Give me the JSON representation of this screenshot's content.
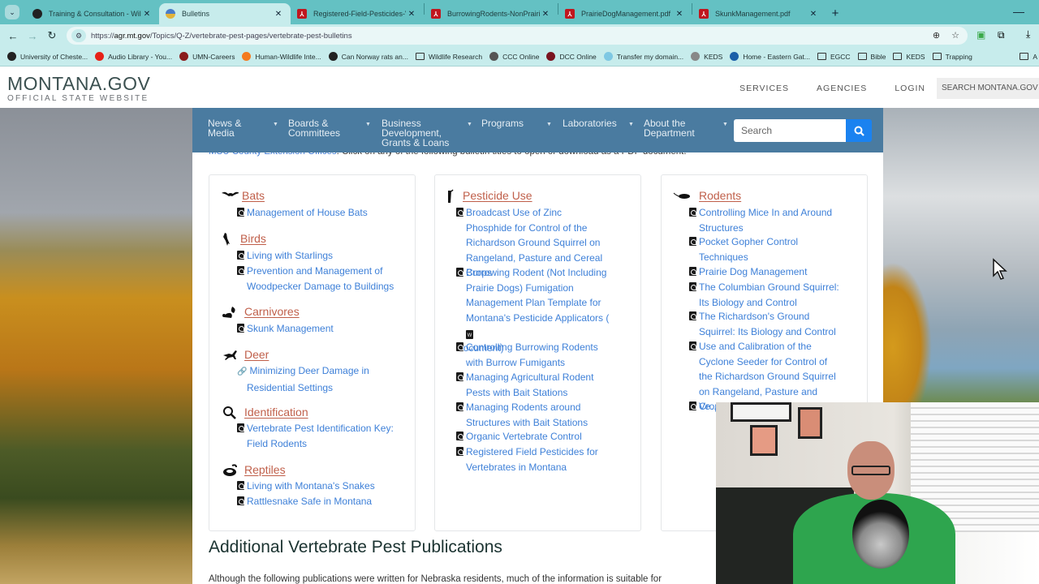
{
  "browser": {
    "tabs": [
      {
        "title": "Training & Consultation - Wildl",
        "icon": "globe-icon",
        "active": false
      },
      {
        "title": "Bulletins",
        "icon": "site-favicon",
        "active": true
      },
      {
        "title": "Registered-Field-Pesticides-Ver",
        "icon": "pdf-icon",
        "active": false
      },
      {
        "title": "BurrowingRodents-NonPrairieD",
        "icon": "pdf-icon",
        "active": false
      },
      {
        "title": "PrairieDogManagement.pdf",
        "icon": "pdf-icon",
        "active": false
      },
      {
        "title": "SkunkManagement.pdf",
        "icon": "pdf-icon",
        "active": false
      }
    ],
    "new_tab": "+",
    "close_glyph": "✕",
    "minimize": "—",
    "url_prefix": "https://",
    "url_domain": "agr.mt.gov",
    "url_path": "/Topics/Q-Z/vertebrate-pest-pages/vertebrate-pest-bulletins",
    "bookmarks": [
      {
        "label": "University of Cheste...",
        "type": "globe",
        "color": "#222222"
      },
      {
        "label": "Audio Library - You...",
        "type": "site",
        "color": "#e62117"
      },
      {
        "label": "UMN-Careers",
        "type": "site",
        "color": "#8a1c1c"
      },
      {
        "label": "Human-Wildlife Inte...",
        "type": "site",
        "color": "#f47b20"
      },
      {
        "label": "Can Norway rats an...",
        "type": "globe",
        "color": "#222222"
      },
      {
        "label": "Wildlife Research",
        "type": "folder",
        "color": ""
      },
      {
        "label": "CCC Online",
        "type": "site",
        "color": "#555555"
      },
      {
        "label": "DCC Online",
        "type": "site",
        "color": "#7a1420"
      },
      {
        "label": "Transfer my domain...",
        "type": "site",
        "color": "#7ec8e3"
      },
      {
        "label": "KEDS",
        "type": "site",
        "color": "#888888"
      },
      {
        "label": "Home - Eastern Gat...",
        "type": "site",
        "color": "#1b5fa8"
      },
      {
        "label": "EGCC",
        "type": "folder",
        "color": ""
      },
      {
        "label": "Bible",
        "type": "folder",
        "color": ""
      },
      {
        "label": "KEDS",
        "type": "folder",
        "color": ""
      },
      {
        "label": "Trapping",
        "type": "folder",
        "color": ""
      },
      {
        "label": "A",
        "type": "folder",
        "color": ""
      }
    ]
  },
  "header": {
    "logo_main": "MONTANA.GOV",
    "logo_sub": "OFFICIAL STATE WEBSITE",
    "links": [
      "SERVICES",
      "AGENCIES",
      "LOGIN"
    ],
    "search_placeholder": "SEARCH MONTANA.GOV"
  },
  "nav": {
    "items": [
      "News & Media",
      "Boards & Committees",
      "Business Development, Grants & Loans",
      "Programs",
      "Laboratories",
      "About the Department"
    ],
    "items_lines": [
      [
        "News &",
        "Media"
      ],
      [
        "Boards &",
        "Committees"
      ],
      [
        "Business",
        "Development,",
        "Grants & Loans"
      ],
      [
        "Programs"
      ],
      [
        "Laboratories"
      ],
      [
        "About the",
        "Department"
      ]
    ],
    "search_placeholder": "Search"
  },
  "intro": {
    "link_text": "MSU County Extension Offices",
    "text": ". Click on any of the following bulletin titles to open or download as a PDF document."
  },
  "columns": [
    {
      "categories": [
        {
          "name": "Bats",
          "icon": "bat-icon",
          "links": [
            {
              "text": "Management of House Bats",
              "type": "pdf"
            }
          ]
        },
        {
          "name": "Birds",
          "icon": "bird-icon",
          "links": [
            {
              "text": "Living with Starlings",
              "type": "pdf"
            },
            {
              "text": "Prevention and Management of Woodpecker Damage to Buildings",
              "type": "pdf"
            }
          ]
        },
        {
          "name": "Carnivores",
          "icon": "skunk-icon",
          "links": [
            {
              "text": "Skunk Management",
              "type": "pdf"
            }
          ]
        },
        {
          "name": "Deer",
          "icon": "deer-icon",
          "links": [
            {
              "text": "Minimizing Deer Damage in Residential Settings",
              "type": "link"
            }
          ]
        },
        {
          "name": "Identification",
          "icon": "magnifier-icon",
          "links": [
            {
              "text": "Vertebrate Pest Identification Key: Field Rodents",
              "type": "pdf"
            }
          ]
        },
        {
          "name": "Reptiles",
          "icon": "snake-icon",
          "links": [
            {
              "text": "Living with Montana's Snakes",
              "type": "pdf"
            },
            {
              "text": "Rattlesnake Safe in Montana",
              "type": "pdf"
            }
          ]
        }
      ]
    },
    {
      "categories": [
        {
          "name": "Pesticide Use",
          "icon": "spray-icon",
          "links": [
            {
              "text": "Broadcast Use of Zinc Phosphide for Control of the Richardson Ground Squirrel on Rangeland, Pasture and Cereal Crops",
              "type": "pdf"
            },
            {
              "text": "Burrowing Rodent (Not Including Prairie Dogs) Fumigation Management Plan Template for Montana's Pesticide Applicators (",
              "type": "pdf",
              "suffix": "Document)"
            },
            {
              "text": "Controlling Burrowing Rodents with Burrow Fumigants",
              "type": "pdf"
            },
            {
              "text": "Managing Agricultural Rodent Pests with Bait Stations",
              "type": "pdf"
            },
            {
              "text": "Managing Rodents around Structures with Bait Stations",
              "type": "pdf"
            },
            {
              "text": "Organic Vertebrate Control",
              "type": "pdf"
            },
            {
              "text": "Registered Field Pesticides for Vertebrates in Montana",
              "type": "pdf"
            }
          ]
        }
      ]
    },
    {
      "categories": [
        {
          "name": "Rodents",
          "icon": "rodent-icon",
          "links": [
            {
              "text": "Controlling Mice In and Around Structures",
              "type": "pdf"
            },
            {
              "text": "Pocket Gopher Control Techniques",
              "type": "pdf"
            },
            {
              "text": "Prairie Dog Management",
              "type": "pdf"
            },
            {
              "text": "The Columbian Ground Squirrel: Its Biology and Control",
              "type": "pdf"
            },
            {
              "text": "The Richardson's Ground Squirrel: Its Biology and Control",
              "type": "pdf"
            },
            {
              "text": "Use and Calibration of the Cyclone Seeder for Control of the Richardson Ground Squirrel on Rangeland, Pasture and Croplands",
              "type": "pdf"
            },
            {
              "text": "Ve… Dam…",
              "type": "pdf"
            }
          ]
        }
      ]
    }
  ],
  "section": {
    "heading": "Additional Vertebrate Pest Publications",
    "paragraph": "Although the following publications were written for Nebraska residents, much of the information is suitable for"
  },
  "colors": {
    "tabbar": "#64c1c3",
    "nav": "#4a7ba0",
    "category_link": "#c0604b",
    "doc_link": "#3e80d8",
    "search_button": "#1a82f0"
  }
}
